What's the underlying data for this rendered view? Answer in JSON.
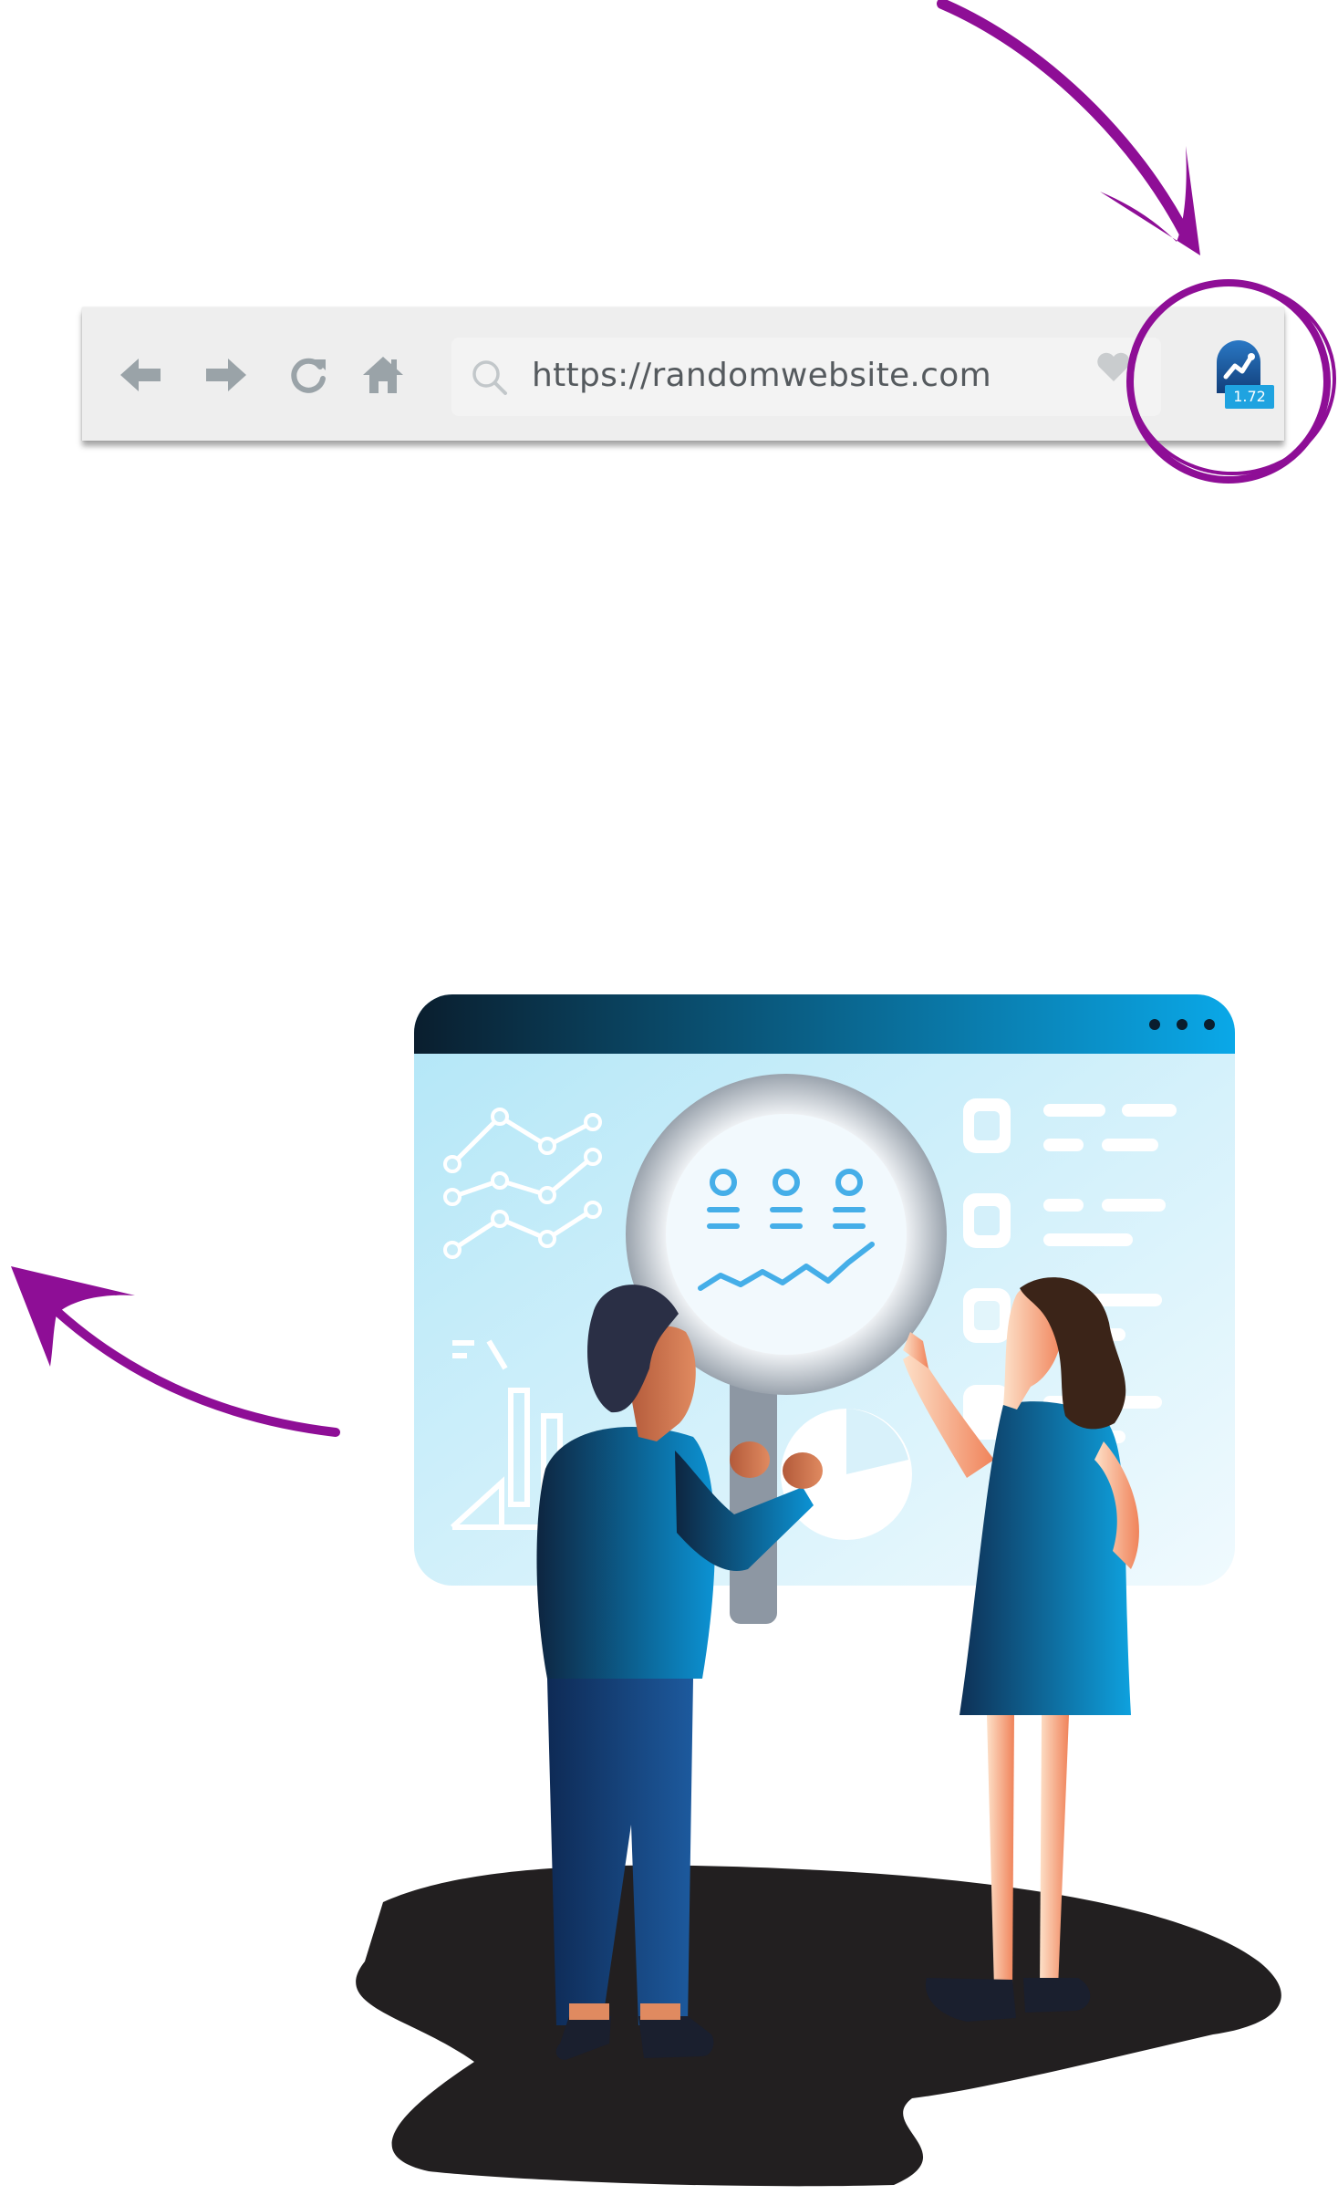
{
  "browser": {
    "url": "https://randomwebsite.com",
    "extension": {
      "icon": "wave-chart-icon",
      "badge": "1.72"
    },
    "buttons": [
      "back-icon",
      "forward-icon",
      "reload-icon",
      "home-icon"
    ]
  },
  "colors": {
    "annotation": "#8e0e96",
    "toolbar": "#eeeeee",
    "icon_gray": "#9aa3a8",
    "accent": "#1fa3e0"
  }
}
